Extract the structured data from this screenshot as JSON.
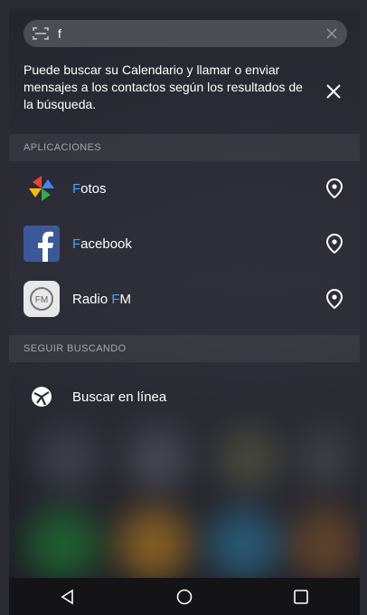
{
  "search": {
    "value": "f"
  },
  "hint": {
    "text": "Puede buscar su Calendario y llamar o enviar mensajes a los contactos según los resultados de la búsqueda."
  },
  "sections": {
    "apps_title": "APLICACIONES",
    "more_title": "SEGUIR BUSCANDO"
  },
  "apps": [
    {
      "prefix": "F",
      "rest": "otos"
    },
    {
      "prefix": "F",
      "rest": "acebook"
    },
    {
      "before": "Radio ",
      "prefix": "F",
      "rest": "M"
    }
  ],
  "search_online": {
    "label": "Buscar en línea"
  },
  "colors": {
    "highlight": "#3ea6ff",
    "facebook": "#3b5998"
  },
  "icons": {
    "scan": "scan-icon",
    "clear": "close-icon",
    "hint_close": "close-icon",
    "location": "location-pin-icon",
    "globe": "globe-icon",
    "back": "back-triangle-icon",
    "home": "home-circle-icon",
    "recents": "recents-square-icon"
  }
}
